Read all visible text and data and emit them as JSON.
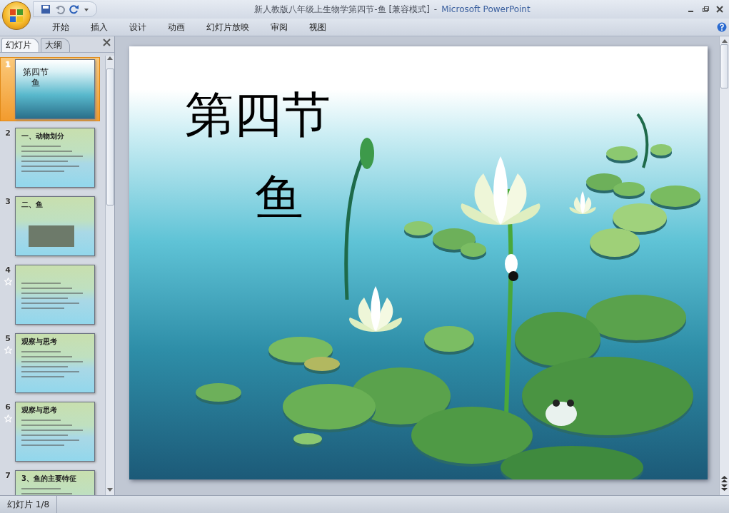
{
  "window": {
    "document_title": "新人教版八年级上生物学第四节-鱼 [兼容模式]",
    "separator": "-",
    "app_name": "Microsoft PowerPoint"
  },
  "ribbon_tabs": [
    {
      "label": "开始"
    },
    {
      "label": "插入"
    },
    {
      "label": "设计"
    },
    {
      "label": "动画"
    },
    {
      "label": "幻灯片放映"
    },
    {
      "label": "审阅"
    },
    {
      "label": "视图"
    }
  ],
  "pane_tabs": [
    {
      "label": "幻灯片",
      "selected": true
    },
    {
      "label": "大纲",
      "selected": false
    }
  ],
  "slides": [
    {
      "number": "1",
      "selected": true,
      "animated": false,
      "kind": "title",
      "title": "第四节",
      "subtitle": "鱼"
    },
    {
      "number": "2",
      "selected": false,
      "animated": false,
      "kind": "text",
      "title": "一、动物划分"
    },
    {
      "number": "3",
      "selected": false,
      "animated": false,
      "kind": "photo",
      "title": "二、鱼"
    },
    {
      "number": "4",
      "selected": false,
      "animated": true,
      "kind": "text"
    },
    {
      "number": "5",
      "selected": false,
      "animated": true,
      "kind": "text",
      "title": "观察与思考"
    },
    {
      "number": "6",
      "selected": false,
      "animated": true,
      "kind": "text",
      "title": "观察与思考"
    },
    {
      "number": "7",
      "selected": false,
      "animated": false,
      "kind": "text",
      "title": "3、鱼的主要特征"
    }
  ],
  "current_slide": {
    "title": "第四节",
    "subtitle": "鱼"
  },
  "status_bar": {
    "slide_counter": "幻灯片 1/8"
  }
}
